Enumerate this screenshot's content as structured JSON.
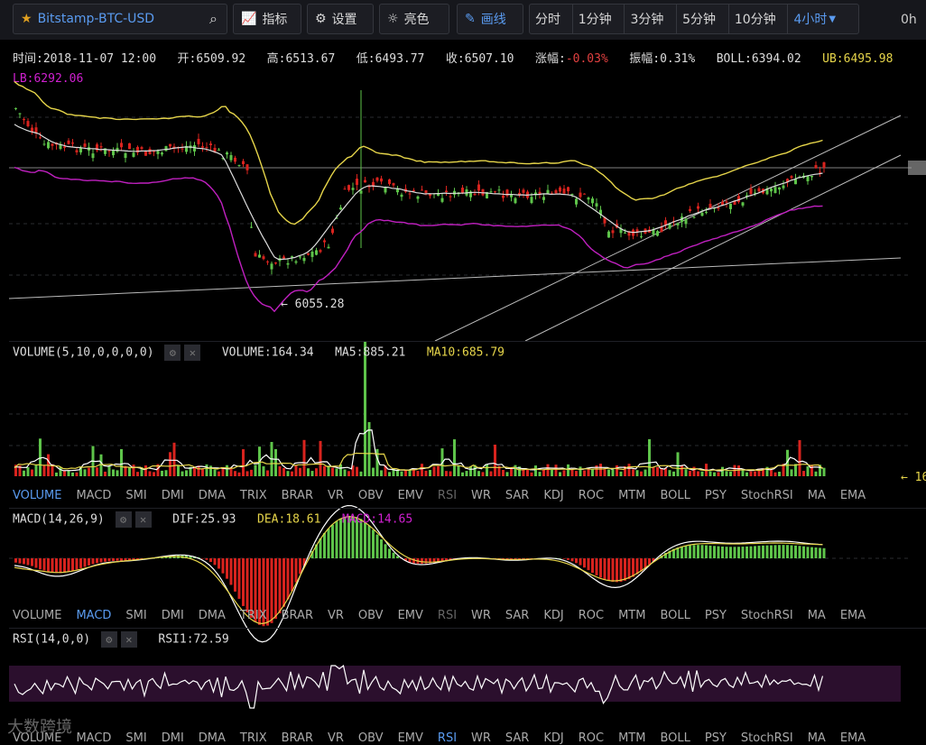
{
  "toolbar": {
    "symbol": "Bitstamp-BTC-USD",
    "indicators": "指标",
    "settings": "设置",
    "theme": "亮色",
    "draw": "画线",
    "timeframes": [
      "分时",
      "1分钟",
      "3分钟",
      "5分钟",
      "10分钟",
      "4小时"
    ],
    "active_timeframe": "4小时",
    "edge": "0h"
  },
  "ohlc": {
    "time_label": "时间:",
    "time": "2018-11-07 12:00",
    "open_label": "开:",
    "open": "6509.92",
    "high_label": "高:",
    "high": "6513.67",
    "low_label": "低:",
    "low": "6493.77",
    "close_label": "收:",
    "close": "6507.10",
    "change_label": "涨幅:",
    "change": "-0.03%",
    "amp_label": "振幅:",
    "amp": "0.31%",
    "boll_label": "BOLL:",
    "boll": "6394.02",
    "ub_label": "UB:",
    "ub": "6495.98",
    "lb_label": "LB:",
    "lb": "6292.06"
  },
  "main_chart": {
    "low_marker": "← 6055.28"
  },
  "volume": {
    "title": "VOLUME(5,10,0,0,0,0)",
    "value_label": "VOLUME:",
    "value": "164.34",
    "ma5_label": "MA5:",
    "ma5": "885.21",
    "ma10_label": "MA10:",
    "ma10": "685.79",
    "right_tag": "← 16"
  },
  "indicator_tabs": [
    "VOLUME",
    "MACD",
    "SMI",
    "DMI",
    "DMA",
    "TRIX",
    "BRAR",
    "VR",
    "OBV",
    "EMV",
    "RSI",
    "WR",
    "SAR",
    "KDJ",
    "ROC",
    "MTM",
    "BOLL",
    "PSY",
    "StochRSI",
    "MA",
    "EMA"
  ],
  "macd": {
    "title": "MACD(14,26,9)",
    "dif_label": "DIF:",
    "dif": "25.93",
    "dea_label": "DEA:",
    "dea": "18.61",
    "macd_label": "MACD:",
    "macd": "14.65"
  },
  "rsi": {
    "title": "RSI(14,0,0)",
    "rsi1_label": "RSI1:",
    "rsi1": "72.59"
  },
  "watermark": "大数跨境",
  "colors": {
    "up": "#5ec44a",
    "down": "#d8231e",
    "boll_ub": "#e6d54a",
    "boll_lb": "#c020c0",
    "boll_mid": "#dddddd",
    "accent": "#5a9bf0",
    "ma10": "#e6d54a",
    "macd_label": "#d020d0"
  }
}
